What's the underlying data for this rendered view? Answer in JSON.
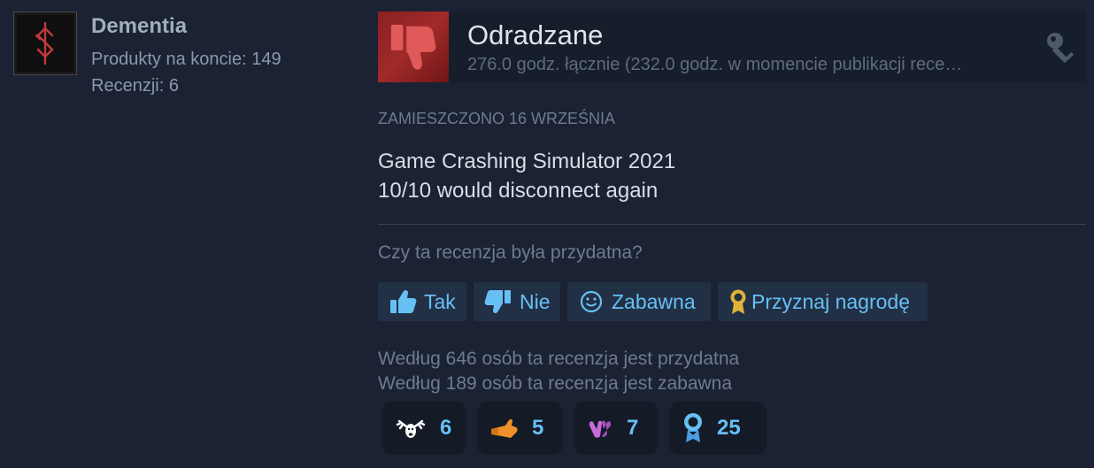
{
  "author": {
    "name": "Dementia",
    "products_label": "Produkty na koncie: 149",
    "reviews_label": "Recenzji: 6",
    "avatar_icon": "rune-avatar-icon"
  },
  "review": {
    "verdict": "Odradzane",
    "verdict_icon": "thumbs-down-icon",
    "hours": "276.0 godz. łącznie (232.0 godz. w momencie publikacji recenzji)",
    "hours_display": "276.0 godz. łącznie (232.0 godz. w momencie publikacji rece…",
    "key_icon": "key-icon",
    "posted": "Zamieszczono 16 września",
    "text_line1": "Game Crashing Simulator 2021",
    "text_line2": "10/10 would disconnect again",
    "helpful_question": "Czy ta recenzja była przydatna?",
    "buttons": {
      "yes": "Tak",
      "no": "Nie",
      "funny": "Zabawna",
      "award": "Przyznaj nagrodę"
    },
    "helpful_count_text": "Według 646 osób ta recenzja jest przydatna",
    "funny_count_text": "Według 189 osób ta recenzja jest zabawna",
    "awards": [
      {
        "icon": "deer-award-icon",
        "count": "6"
      },
      {
        "icon": "hand-award-icon",
        "count": "5"
      },
      {
        "icon": "clap-award-icon",
        "count": "7"
      },
      {
        "icon": "ribbon-award-icon",
        "count": "25"
      }
    ]
  },
  "colors": {
    "background": "#1b2233",
    "accent": "#66c0f4",
    "negative": "#a12a2a"
  }
}
